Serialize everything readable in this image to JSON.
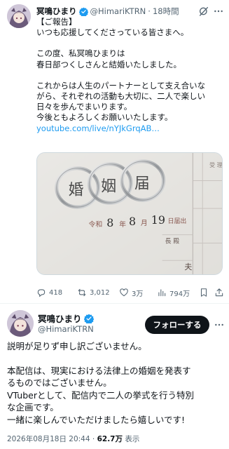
{
  "tweet1": {
    "display_name": "冥鳴ひまり",
    "handle": "@HimariKTRN",
    "separator": "·",
    "time": "18時間",
    "lines": [
      "【ご報告】",
      "いつも応援してくださっている皆さまへ。"
    ],
    "para2": [
      "この度、私冥鳴ひまりは",
      "春日部つくしさんと結婚いたしました。"
    ],
    "para3": [
      "これからは人生のパートナーとして支え合いな",
      "がら、それぞれの活動も大切に、二人で楽しい",
      "日々を歩んでまいります。",
      "今後ともよろしくお願いいたします。"
    ],
    "link": "youtube.com/live/nYJkGrqAB…",
    "media": {
      "form_title_chars": [
        "婚",
        "姻",
        "届"
      ],
      "era": "令和",
      "year": "8",
      "year_unit": "年",
      "month": "8",
      "month_unit": "月",
      "day": "19",
      "day_unit": "日届出",
      "recipient_suffix": "長 殿",
      "husband_label": "夫",
      "side_label": "受 理"
    },
    "actions": {
      "replies": "418",
      "reposts": "3,012",
      "likes": "3万",
      "views": "794万"
    }
  },
  "tweet2": {
    "display_name": "冥鳴ひまり",
    "handle": "@HimariKTRN",
    "follow_label": "フォローする",
    "para1": "説明が足りず申し訳ございません。",
    "para2": [
      "本配信は、現実における法律上の婚姻を発表す",
      "るものではございません。",
      "VTuberとして、配信内で二人の挙式を行う特別",
      "な企画です。",
      "一緒に楽しんでいただけましたら嬉しいです!"
    ],
    "timestamp": "2026年08月18日 20:44",
    "separator": "·",
    "view_count": "62.7万",
    "view_label": "表示"
  },
  "colors": {
    "accent": "#1d9bf0",
    "text": "#0f1419",
    "muted": "#536471"
  },
  "icons": [
    "verified-badge-icon",
    "grok-icon",
    "more-icon",
    "reply-icon",
    "repost-icon",
    "like-icon",
    "views-icon",
    "bookmark-icon",
    "share-icon"
  ]
}
